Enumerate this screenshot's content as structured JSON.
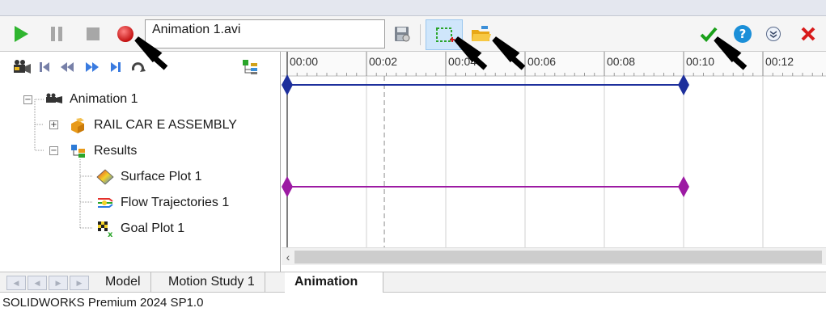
{
  "toolbar": {
    "filename": "Animation 1.avi",
    "icons": [
      "play-icon",
      "pause-icon",
      "stop-icon",
      "record-icon",
      "save-settings-icon",
      "select-region-icon",
      "open-folder-icon",
      "ok-check-icon",
      "help-icon",
      "collapse-icon",
      "close-icon"
    ]
  },
  "navigation": {
    "icons": [
      "camera-view-icon",
      "go-to-start-icon",
      "rewind-icon",
      "fast-forward-icon",
      "go-to-end-icon",
      "loop-icon",
      "filter-tree-icon"
    ]
  },
  "tree": {
    "root": "Animation 1",
    "items": [
      {
        "label": "RAIL CAR E ASSEMBLY",
        "icon": "assembly-icon"
      },
      {
        "label": "Results",
        "icon": "results-icon"
      },
      {
        "label": "Surface Plot 1",
        "icon": "surface-plot-icon"
      },
      {
        "label": "Flow Trajectories 1",
        "icon": "flow-trajectories-icon"
      },
      {
        "label": "Goal Plot 1",
        "icon": "goal-plot-icon"
      }
    ]
  },
  "timeline": {
    "ticks": [
      "00:00",
      "00:02",
      "00:04",
      "00:06",
      "00:08",
      "00:10",
      "00:12"
    ],
    "tracks": [
      {
        "color": "#1d2f9c",
        "start": "00:00",
        "end": "00:10"
      },
      {
        "color": "#9c1aa3",
        "start": "00:00",
        "end": "00:10"
      }
    ]
  },
  "tabs": {
    "items": [
      "Model",
      "Motion Study 1",
      "Animation"
    ],
    "active": "Animation"
  },
  "status": {
    "text": "SOLIDWORKS Premium 2024 SP1.0"
  },
  "colors": {
    "play": "#2fb52f",
    "record": "#d71a1a",
    "ok": "#1aa01a",
    "help": "#1b8fd8",
    "close": "#d81b1b"
  }
}
